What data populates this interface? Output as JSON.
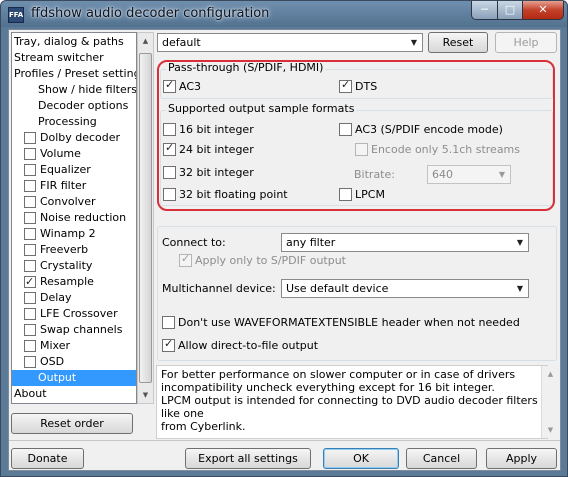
{
  "window": {
    "title": "ffdshow audio decoder configuration",
    "icon_text": "FFA",
    "min": "─",
    "max": "□",
    "close": "✕"
  },
  "tree": {
    "items": [
      {
        "label": "Tray, dialog & paths",
        "indent": 0
      },
      {
        "label": "Stream switcher",
        "indent": 0
      },
      {
        "label": "Profiles / Preset settings",
        "indent": 0
      },
      {
        "label": "Show / hide filters",
        "indent": 2
      },
      {
        "label": "Decoder options",
        "indent": 2
      },
      {
        "label": "Processing",
        "indent": 2
      },
      {
        "label": "Dolby decoder",
        "indent": 1,
        "checkbox": true,
        "checked": false
      },
      {
        "label": "Volume",
        "indent": 1,
        "checkbox": true,
        "checked": false
      },
      {
        "label": "Equalizer",
        "indent": 1,
        "checkbox": true,
        "checked": false
      },
      {
        "label": "FIR filter",
        "indent": 1,
        "checkbox": true,
        "checked": false
      },
      {
        "label": "Convolver",
        "indent": 1,
        "checkbox": true,
        "checked": false
      },
      {
        "label": "Noise reduction",
        "indent": 1,
        "checkbox": true,
        "checked": false
      },
      {
        "label": "Winamp 2",
        "indent": 1,
        "checkbox": true,
        "checked": false
      },
      {
        "label": "Freeverb",
        "indent": 1,
        "checkbox": true,
        "checked": false
      },
      {
        "label": "Crystality",
        "indent": 1,
        "checkbox": true,
        "checked": false
      },
      {
        "label": "Resample",
        "indent": 1,
        "checkbox": true,
        "checked": true
      },
      {
        "label": "Delay",
        "indent": 1,
        "checkbox": true,
        "checked": false
      },
      {
        "label": "LFE Crossover",
        "indent": 1,
        "checkbox": true,
        "checked": false
      },
      {
        "label": "Swap channels",
        "indent": 1,
        "checkbox": true,
        "checked": false
      },
      {
        "label": "Mixer",
        "indent": 1,
        "checkbox": true,
        "checked": false
      },
      {
        "label": "OSD",
        "indent": 1,
        "checkbox": true,
        "checked": false
      },
      {
        "label": "Output",
        "indent": 2,
        "selected": true
      },
      {
        "label": "About",
        "indent": 0
      }
    ],
    "reset_order": "Reset order"
  },
  "preset": {
    "value": "default",
    "reset": "Reset",
    "help": "Help"
  },
  "passthrough": {
    "title": "Pass-through (S/PDIF, HDMI)",
    "ac3": "AC3",
    "ac3_checked": true,
    "dts": "DTS",
    "dts_checked": true
  },
  "formats": {
    "title": "Supported output sample formats",
    "int16": "16 bit integer",
    "int16_checked": false,
    "int24": "24 bit integer",
    "int24_checked": true,
    "int32": "32 bit integer",
    "int32_checked": false,
    "float32": "32 bit floating point",
    "float32_checked": false,
    "ac3_encode": "AC3 (S/PDIF encode mode)",
    "ac3_encode_checked": false,
    "encode_51": "Encode only 5.1ch streams",
    "encode_51_checked": false,
    "bitrate_label": "Bitrate:",
    "bitrate_value": "640",
    "lpcm": "LPCM",
    "lpcm_checked": false
  },
  "connect": {
    "label": "Connect to:",
    "value": "any filter",
    "apply_spdif": "Apply only to S/PDIF output",
    "apply_spdif_checked": true,
    "multich_label": "Multichannel device:",
    "multich_value": "Use default device",
    "waveformat": "Don't use WAVEFORMATEXTENSIBLE header when not needed",
    "waveformat_checked": false,
    "direct_file": "Allow direct-to-file output",
    "direct_file_checked": true
  },
  "info": {
    "line1": "For better performance on slower computer or in case of drivers",
    "line2": "incompatibility uncheck everything except for 16 bit integer.",
    "line3": "LPCM output is intended for connecting to DVD audio decoder filters like one",
    "line4": "from Cyberlink."
  },
  "footer": {
    "donate": "Donate",
    "export": "Export all settings",
    "ok": "OK",
    "cancel": "Cancel",
    "apply": "Apply"
  }
}
